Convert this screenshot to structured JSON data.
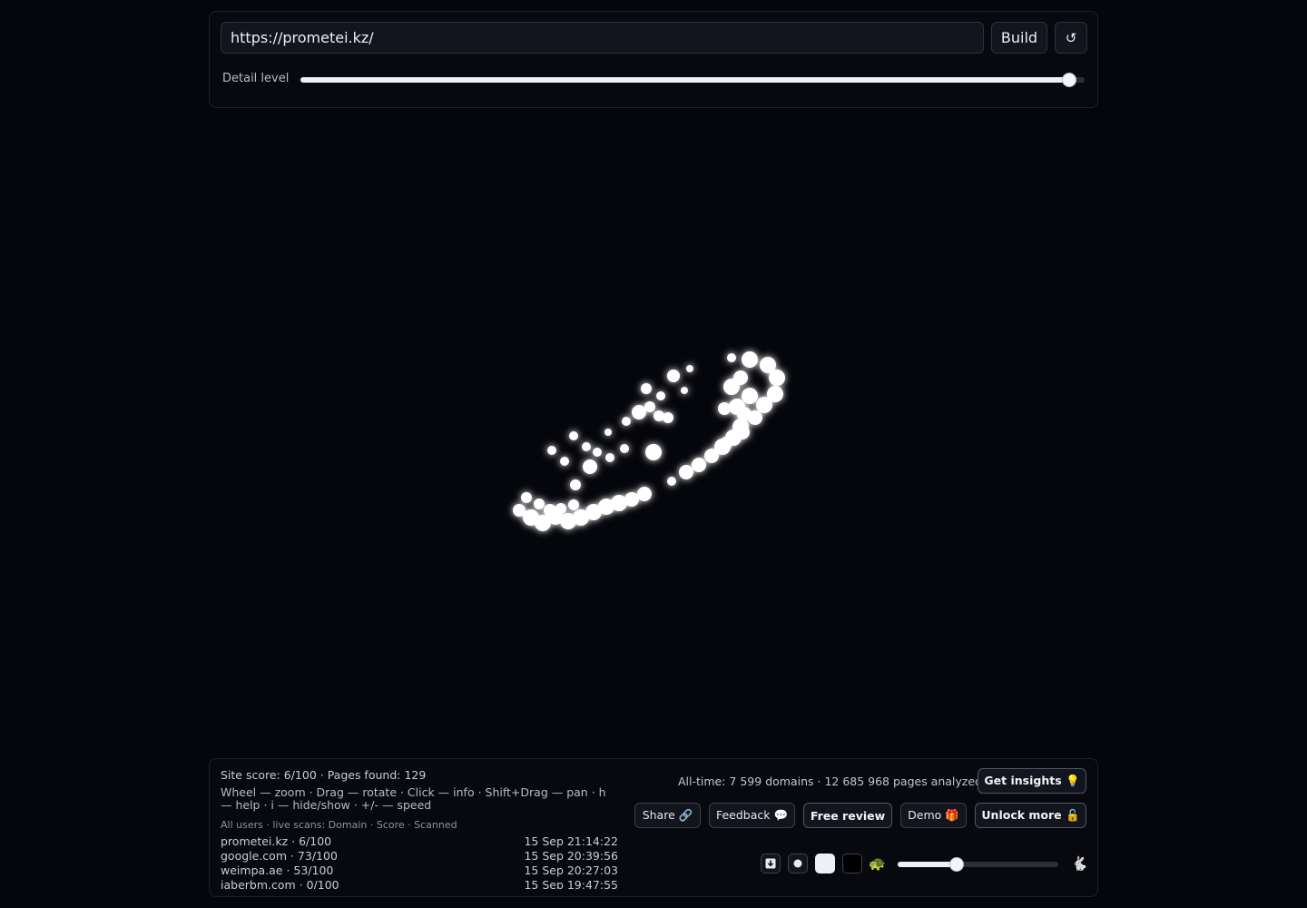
{
  "top": {
    "url_value": "https://prometei.kz/",
    "build_label": "Build",
    "refresh_glyph": "↺",
    "detail_label": "Detail level",
    "detail_level": 0.98
  },
  "stats": {
    "site_score": "Site score: 6/100 · Pages found: 129",
    "help": "Wheel — zoom · Drag — rotate · Click — info · Shift+Drag — pan · h — help · i — hide/show · +/- — speed",
    "scans_header": "All users · live scans: Domain · Score · Scanned",
    "alltime": "All-time: 7 599 domains · 12 685 968 pages analyzed"
  },
  "scans": [
    {
      "domain": "prometei.kz · 6/100",
      "time": "15 Sep 21:14:22"
    },
    {
      "domain": "google.com · 73/100",
      "time": "15 Sep 20:39:56"
    },
    {
      "domain": "weimpa.ae · 53/100",
      "time": "15 Sep 20:27:03"
    },
    {
      "domain": "jaberbm.com · 0/100",
      "time": "15 Sep 19:47:55"
    }
  ],
  "buttons": {
    "get_insights": "Get insights 💡",
    "share": "Share 🔗",
    "feedback": "Feedback 💬",
    "free_review": "Free review",
    "demo": "Demo 🎁",
    "unlock_more": "Unlock more 🔓"
  },
  "controls": {
    "speed_level": 0.37,
    "slow_icon": "🐢",
    "fast_icon": "🐇",
    "icons": [
      "download-icon",
      "dot-icon",
      "light-theme-icon",
      "dark-theme-icon",
      "turtle-icon",
      "rabbit-icon"
    ]
  },
  "colors": {
    "background": "#05060b",
    "node": "#ffffff",
    "glow": "#dfe4ff"
  }
}
